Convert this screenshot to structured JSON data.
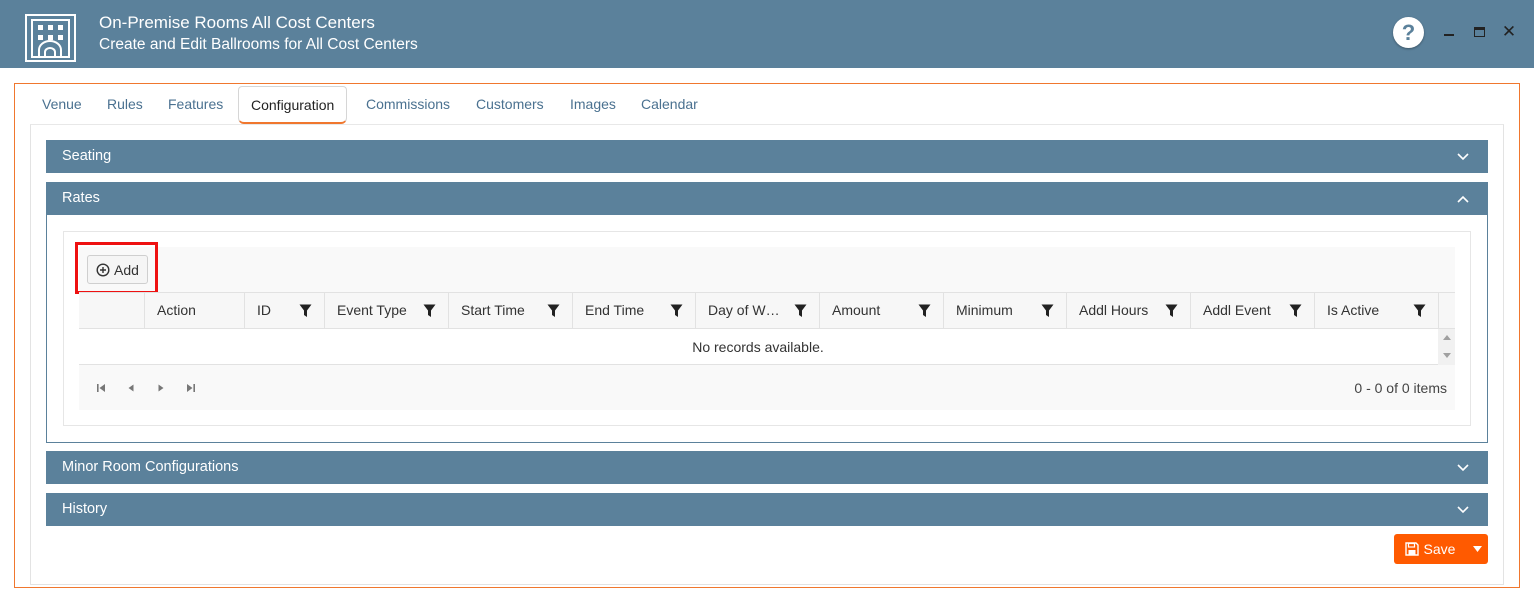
{
  "window": {
    "title": "On-Premise Rooms All Cost Centers",
    "subtitle": "Create and Edit Ballrooms for All Cost Centers",
    "help_label": "?",
    "close_label": "✕",
    "accent_color": "#5b819b"
  },
  "tabs": [
    {
      "label": "Venue",
      "active": false
    },
    {
      "label": "Rules",
      "active": false
    },
    {
      "label": "Features",
      "active": false
    },
    {
      "label": "Configuration",
      "active": true
    },
    {
      "label": "Commissions",
      "active": false
    },
    {
      "label": "Customers",
      "active": false
    },
    {
      "label": "Images",
      "active": false
    },
    {
      "label": "Calendar",
      "active": false
    }
  ],
  "panels": {
    "seating": {
      "title": "Seating",
      "expanded": false
    },
    "rates": {
      "title": "Rates",
      "expanded": true
    },
    "minor": {
      "title": "Minor Room Configurations",
      "expanded": false
    },
    "history": {
      "title": "History",
      "expanded": false
    }
  },
  "rates_grid": {
    "add_label": "Add",
    "columns": [
      "Action",
      "ID",
      "Event Type",
      "Start Time",
      "End Time",
      "Day of W…",
      "Amount",
      "Minimum",
      "Addl Hours",
      "Addl Event",
      "Is Active"
    ],
    "empty_message": "No records available.",
    "pager_info": "0 - 0 of 0 items"
  },
  "footer": {
    "save_label": "Save",
    "save_color": "#ff5a00"
  }
}
